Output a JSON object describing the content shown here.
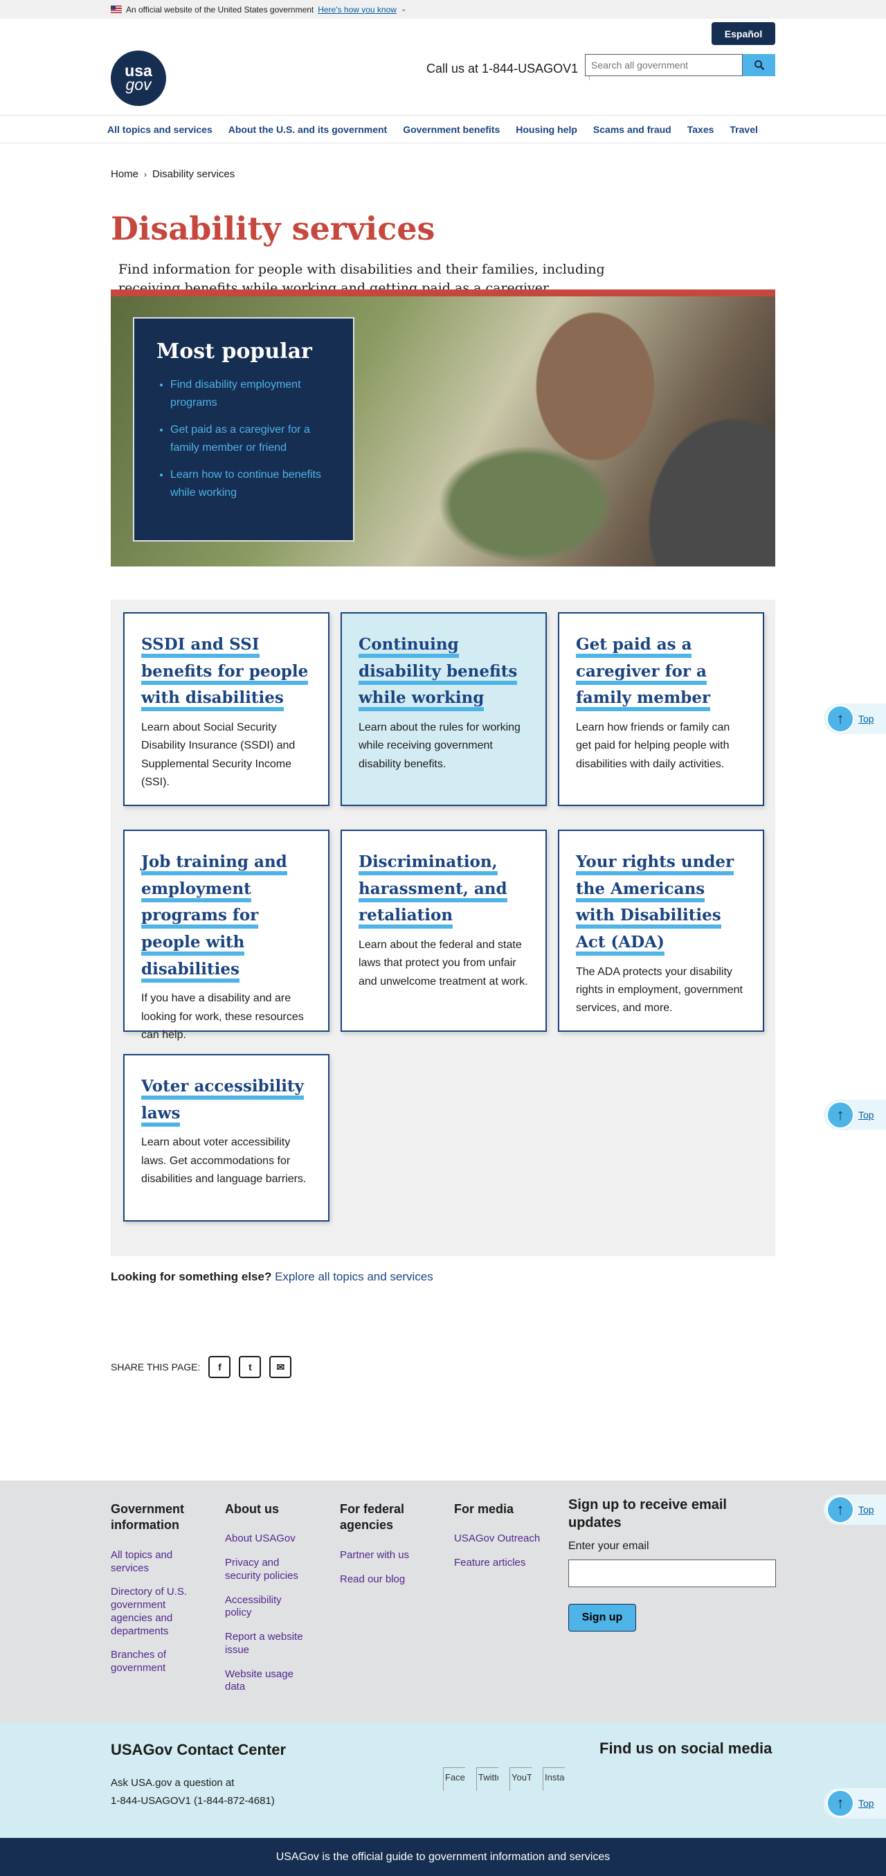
{
  "banner": {
    "text": "An official website of the United States government",
    "link": "Here's how you know"
  },
  "header": {
    "logo_top": "usa",
    "logo_bottom": "gov",
    "espanol": "Español",
    "call": "Call us at 1-844-USAGOV1",
    "search_placeholder": "Search all government"
  },
  "nav": [
    "All topics and services",
    "About the U.S. and its government",
    "Government benefits",
    "Housing help",
    "Scams and fraud",
    "Taxes",
    "Travel"
  ],
  "breadcrumb": {
    "home": "Home",
    "current": "Disability services"
  },
  "page": {
    "title": "Disability services",
    "intro": "Find information for people with disabilities and their families, including receiving benefits while working and getting paid as a caregiver."
  },
  "popular": {
    "title": "Most popular",
    "items": [
      "Find disability employment programs",
      "Get paid as a caregiver for a family member or friend",
      "Learn how to continue benefits while working"
    ]
  },
  "cards": [
    {
      "title": "SSDI and SSI benefits for people with disabilities",
      "text": "Learn about Social Security Disability Insurance (SSDI) and Supplemental Security Income (SSI)."
    },
    {
      "title": "Continuing disability benefits while working",
      "text": "Learn about the rules for working while receiving government disability benefits."
    },
    {
      "title": "Get paid as a caregiver for a family member",
      "text": "Learn how friends or family can get paid for helping people with disabilities with daily activities."
    },
    {
      "title": "Job training and employment programs for people with disabilities",
      "text": "If you have a disability and are looking for work, these resources can help."
    },
    {
      "title": "Discrimination, harassment, and retaliation",
      "text": "Learn about the federal and state laws that protect you from unfair and unwelcome treatment at work."
    },
    {
      "title": "Your rights under the Americans with Disabilities Act (ADA)",
      "text": "The ADA protects your disability rights in employment, government services, and more."
    },
    {
      "title": "Voter accessibility laws",
      "text": "Learn about voter accessibility laws. Get accommodations for disabilities and language barriers."
    }
  ],
  "looking": {
    "label": "Looking for something else?",
    "link": "Explore all topics and services"
  },
  "share": {
    "label": "SHARE THIS PAGE:"
  },
  "top_label": "Top",
  "footer": {
    "cols": [
      {
        "title": "Government information",
        "links": [
          "All topics and services",
          "Directory of U.S. government agencies and departments",
          "Branches of government"
        ]
      },
      {
        "title": "About us",
        "links": [
          "About USAGov",
          "Privacy and security policies",
          "Accessibility policy",
          "Report a website issue",
          "Website usage data"
        ]
      },
      {
        "title": "For federal agencies",
        "links": [
          "Partner with us",
          "Read our blog"
        ]
      },
      {
        "title": "For media",
        "links": [
          "USAGov Outreach",
          "Feature articles"
        ]
      }
    ],
    "signup": {
      "title": "Sign up to receive email updates",
      "label": "Enter your email",
      "button": "Sign up"
    }
  },
  "contact": {
    "title": "USAGov Contact Center",
    "line1": "Ask USA.gov a question at",
    "line2": "1-844-USAGOV1 (1-844-872-4681)",
    "social_title": "Find us on social media",
    "social": [
      "Facebook",
      "Twitter",
      "YouTube",
      "Instagram"
    ]
  },
  "bottom": "USAGov is the official guide to government information and services"
}
